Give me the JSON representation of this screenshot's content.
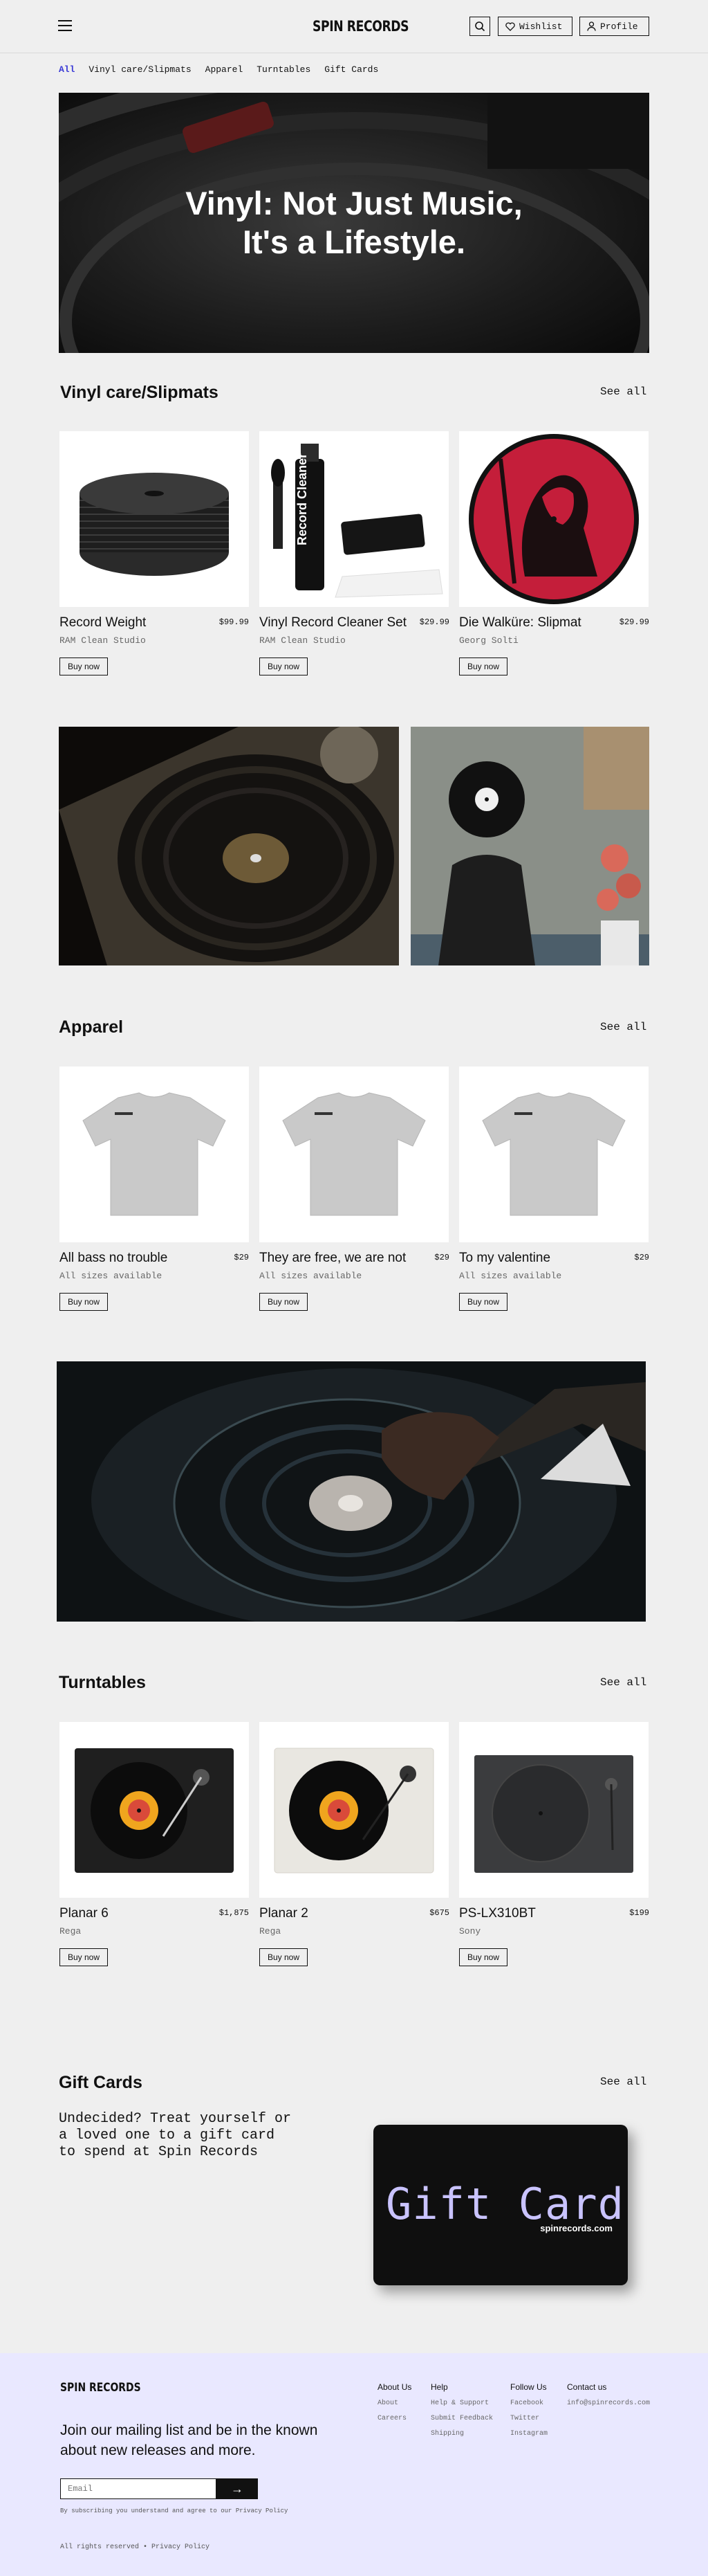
{
  "header": {
    "logo": "SPIN RECORDS",
    "wishlist": "Wishlist",
    "profile": "Profile"
  },
  "nav": {
    "categories": [
      "All",
      "Vinyl care/Slipmats",
      "Apparel",
      "Turntables",
      "Gift Cards"
    ]
  },
  "hero": {
    "line1": "Vinyl: Not Just Music,",
    "line2": "It's a Lifestyle."
  },
  "sections": {
    "vinyl": {
      "title": "Vinyl care/Slipmats",
      "see_all": "See all",
      "products": [
        {
          "name": "Record Weight",
          "price": "$99.99",
          "sub": "RAM Clean Studio",
          "buy": "Buy now"
        },
        {
          "name": "Vinyl Record Cleaner Set",
          "price": "$29.99",
          "sub": "RAM Clean Studio",
          "buy": "Buy now"
        },
        {
          "name": "Die Walküre: Slipmat",
          "price": "$29.99",
          "sub": "Georg Solti",
          "buy": "Buy now"
        }
      ]
    },
    "apparel": {
      "title": "Apparel",
      "see_all": "See all",
      "products": [
        {
          "name": "All bass no trouble",
          "price": "$29",
          "sub": "All sizes available",
          "buy": "Buy now"
        },
        {
          "name": "They are free, we are not",
          "price": "$29",
          "sub": "All sizes available",
          "buy": "Buy now"
        },
        {
          "name": "To my valentine",
          "price": "$29",
          "sub": "All sizes available",
          "buy": "Buy now"
        }
      ]
    },
    "turntables": {
      "title": "Turntables",
      "see_all": "See all",
      "products": [
        {
          "name": "Planar 6",
          "price": "$1,875",
          "sub": "Rega",
          "buy": "Buy now"
        },
        {
          "name": "Planar 2",
          "price": "$675",
          "sub": "Rega",
          "buy": "Buy now"
        },
        {
          "name": "PS-LX310BT",
          "price": "$199",
          "sub": "Sony",
          "buy": "Buy now"
        }
      ]
    },
    "giftcards": {
      "title": "Gift Cards",
      "see_all": "See all",
      "description": "Undecided? Treat yourself or a loved one to a gift card to spend at Spin Records",
      "card_title": "Gift Card",
      "card_url": "spinrecords.com"
    }
  },
  "product_labels": {
    "cleaner_bottle": "Record Cleaner"
  },
  "footer": {
    "logo": "SPIN RECORDS",
    "pitch": "Join our mailing list and be in the known about new releases and more.",
    "email_placeholder": "Email",
    "submit_icon": "→",
    "note": "By subscribing you understand and agree to our Privacy Policy",
    "rights": "All rights reserved • Privacy Policy",
    "columns": [
      {
        "heading": "About Us",
        "links": [
          "About",
          "Careers"
        ]
      },
      {
        "heading": "Help",
        "links": [
          "Help & Support",
          "Submit Feedback",
          "Shipping"
        ]
      },
      {
        "heading": "Follow Us",
        "links": [
          "Facebook",
          "Twitter",
          "Instagram"
        ]
      },
      {
        "heading": "Contact us",
        "links": [
          "info@spinrecords.com"
        ]
      }
    ]
  },
  "colors": {
    "accent": "#3b3bd6",
    "footer_bg": "#e9e8ff",
    "gift_card_text": "#c9c3ff",
    "page_bg": "#efefef"
  }
}
